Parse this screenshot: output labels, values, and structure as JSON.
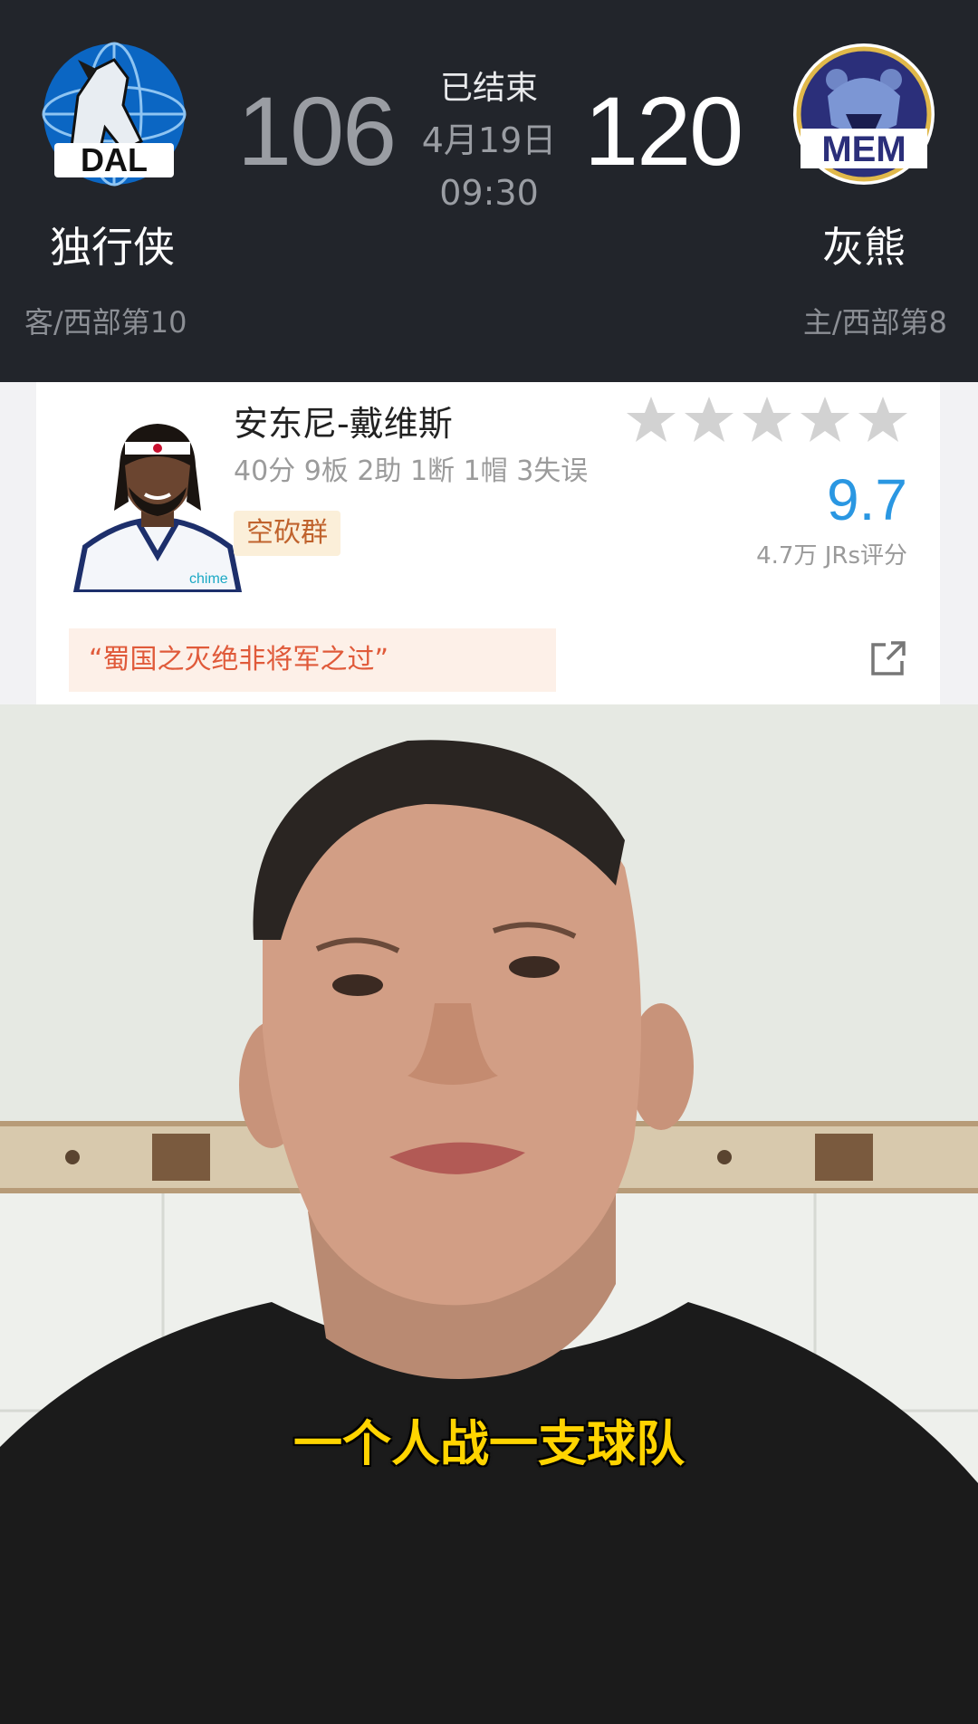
{
  "game": {
    "status": "已结束",
    "date": "4月19日",
    "time": "09:30",
    "away": {
      "abbr": "DAL",
      "name": "独行侠",
      "score": "106",
      "rank": "客/西部第10",
      "color": "#0b66c3"
    },
    "home": {
      "abbr": "MEM",
      "name": "灰熊",
      "score": "120",
      "rank": "主/西部第8",
      "color": "#2b2f7a"
    }
  },
  "player": {
    "name": "安东尼-戴维斯",
    "stats": "40分 9板 2助 1断 1帽 3失误",
    "tag": "空砍群",
    "stars_filled": 0,
    "stars_total": 5,
    "rating": "9.7",
    "rating_count": "4.7万 JRs评分",
    "comment": "“蜀国之灭绝非将军之过”",
    "jersey_text": "chime"
  },
  "video": {
    "caption": "一个人战一支球队"
  },
  "icons": {
    "share": "share-icon",
    "star": "star-icon"
  }
}
